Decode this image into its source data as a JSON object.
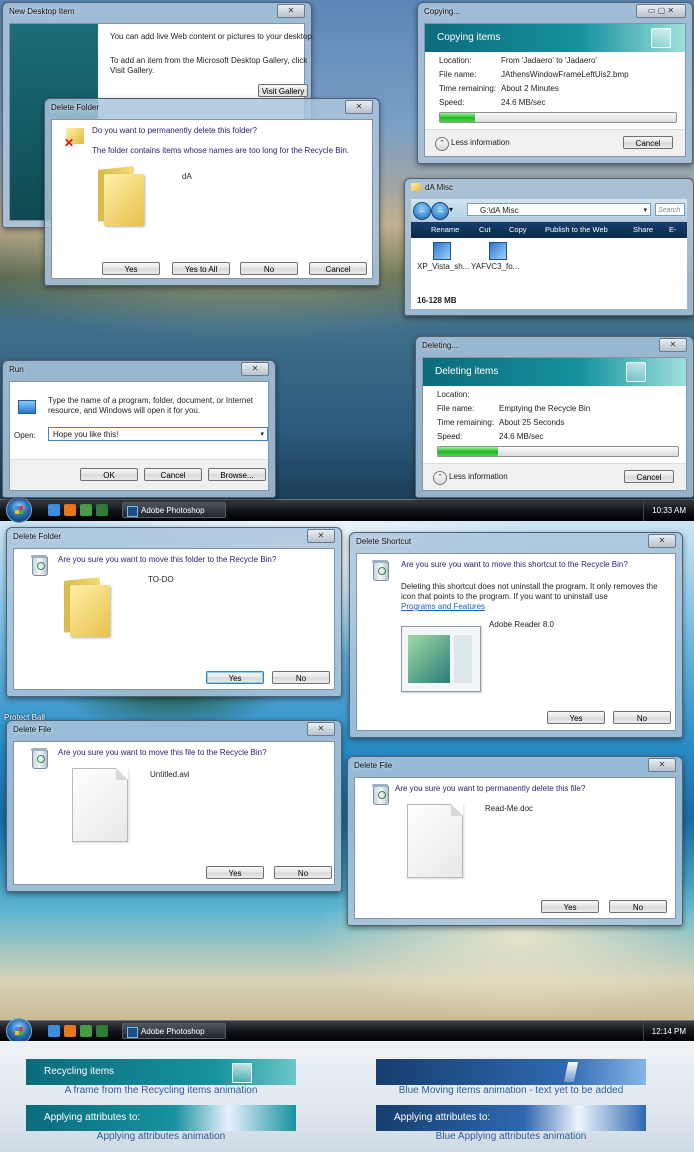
{
  "taskbar1": {
    "app": "Adobe Photoshop",
    "clock": "10:33 AM"
  },
  "taskbar2": {
    "app": "Adobe Photoshop",
    "clock": "12:14 PM"
  },
  "new_desktop_item": {
    "title": "New Desktop Item",
    "text1": "You can add live Web content or pictures to your desktop.",
    "text2": "To add an item from the Microsoft Desktop Gallery, click",
    "text3": "Visit Gallery.",
    "button": "Visit Gallery"
  },
  "delete_folder_top": {
    "title": "Delete Folder",
    "question": "Do you want to permanently delete this folder?",
    "note": "The folder contains items whose names are too long for the Recycle Bin.",
    "item_name": "dA",
    "buttons": [
      "Yes",
      "Yes to All",
      "No",
      "Cancel"
    ]
  },
  "copying": {
    "title": "Copying...",
    "header": "Copying items",
    "rows": [
      {
        "label": "Location:",
        "value": "From 'Jadaero' to 'Jadaero'"
      },
      {
        "label": "File name:",
        "value": "JAthensWindowFrameLeftUis2.bmp"
      },
      {
        "label": "Time remaining:",
        "value": "About 2 Minutes"
      },
      {
        "label": "Speed:",
        "value": "24.6 MB/sec"
      }
    ],
    "progress": 0.15,
    "less": "Less information",
    "cancel": "Cancel"
  },
  "explorer": {
    "title": "dA Misc",
    "address": "G:\\dA Misc",
    "search": "Search",
    "commands": [
      "Rename",
      "Cut",
      "Copy",
      "Publish to the Web",
      "Share",
      "E-mail"
    ],
    "files": [
      "XP_Vista_sh...",
      "YAFVC3_fo..."
    ],
    "status": "16-128 MB"
  },
  "deleting": {
    "title": "Deleting...",
    "header": "Deleting items",
    "rows": [
      {
        "label": "Location:",
        "value": ""
      },
      {
        "label": "File name:",
        "value": "Emptying the Recycle Bin"
      },
      {
        "label": "Time remaining:",
        "value": "About 25 Seconds"
      },
      {
        "label": "Speed:",
        "value": "24.6 MB/sec"
      }
    ],
    "progress": 0.25,
    "less": "Less information",
    "cancel": "Cancel"
  },
  "run": {
    "title": "Run",
    "desc1": "Type the name of a program, folder, document, or Internet",
    "desc2": "resource, and Windows will open it for you.",
    "open_label": "Open:",
    "open_value": "Hope you like this!",
    "buttons": [
      "OK",
      "Cancel",
      "Browse..."
    ]
  },
  "delete_folder_b": {
    "title": "Delete Folder",
    "question": "Are you sure you want to move this folder to the Recycle Bin?",
    "item_name": "TO-DO",
    "buttons": [
      "Yes",
      "No"
    ]
  },
  "delete_shortcut": {
    "title": "Delete Shortcut",
    "question": "Are you sure you want to move this shortcut to the Recycle Bin?",
    "note1": "Deleting this shortcut does not uninstall the program. It only removes the",
    "note2": "icon that points to the program. If you want to uninstall use",
    "link": "Programs and Features",
    "item_name": "Adobe Reader 8.0",
    "buttons": [
      "Yes",
      "No"
    ]
  },
  "delete_file_a": {
    "title": "Delete File",
    "question": "Are you sure you want to move this file to the Recycle Bin?",
    "item_name": "Untitled.avi",
    "buttons": [
      "Yes",
      "No"
    ]
  },
  "delete_file_b": {
    "title": "Delete File",
    "question": "Are you sure you want to permanently delete this file?",
    "item_name": "Read-Me.doc",
    "buttons": [
      "Yes",
      "No"
    ]
  },
  "desktop_label": "Protect Ball",
  "animations": [
    {
      "label": "Recycling items",
      "caption": "A frame from the Recycling items animation"
    },
    {
      "label": "",
      "caption": "Blue Moving items animation - text yet to be added"
    },
    {
      "label": "Applying attributes to:",
      "caption": "Applying attributes animation"
    },
    {
      "label": "Applying attributes to:",
      "caption": "Blue Applying attributes animation"
    }
  ],
  "colors": {
    "teal": "#0c6b7c",
    "blue": "#163e6e",
    "progress": "#22b523"
  }
}
